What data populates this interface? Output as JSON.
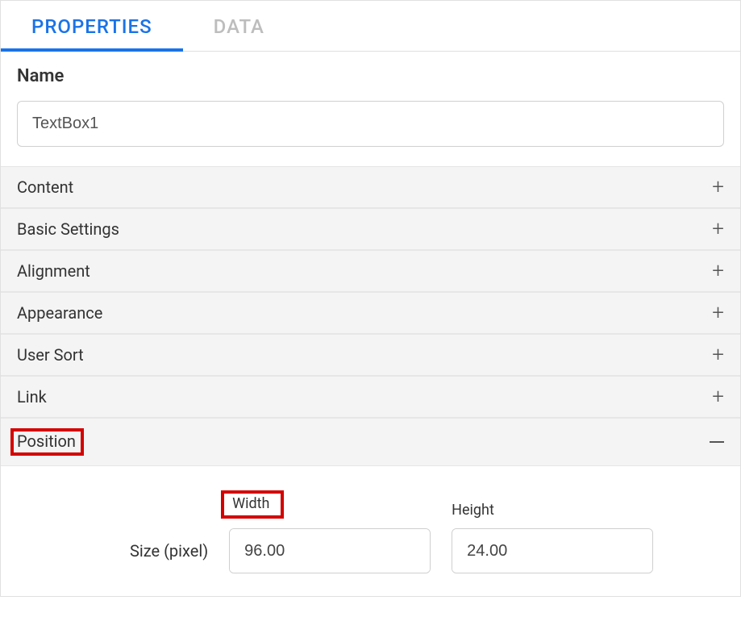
{
  "tabs": {
    "properties": "PROPERTIES",
    "data": "DATA"
  },
  "name": {
    "label": "Name",
    "value": "TextBox1"
  },
  "sections": {
    "content": "Content",
    "basic_settings": "Basic Settings",
    "alignment": "Alignment",
    "appearance": "Appearance",
    "user_sort": "User Sort",
    "link": "Link",
    "position": "Position"
  },
  "position": {
    "size_label": "Size (pixel)",
    "width_label": "Width",
    "height_label": "Height",
    "width_value": "96.00",
    "height_value": "24.00"
  },
  "icons": {
    "plus": "+"
  }
}
